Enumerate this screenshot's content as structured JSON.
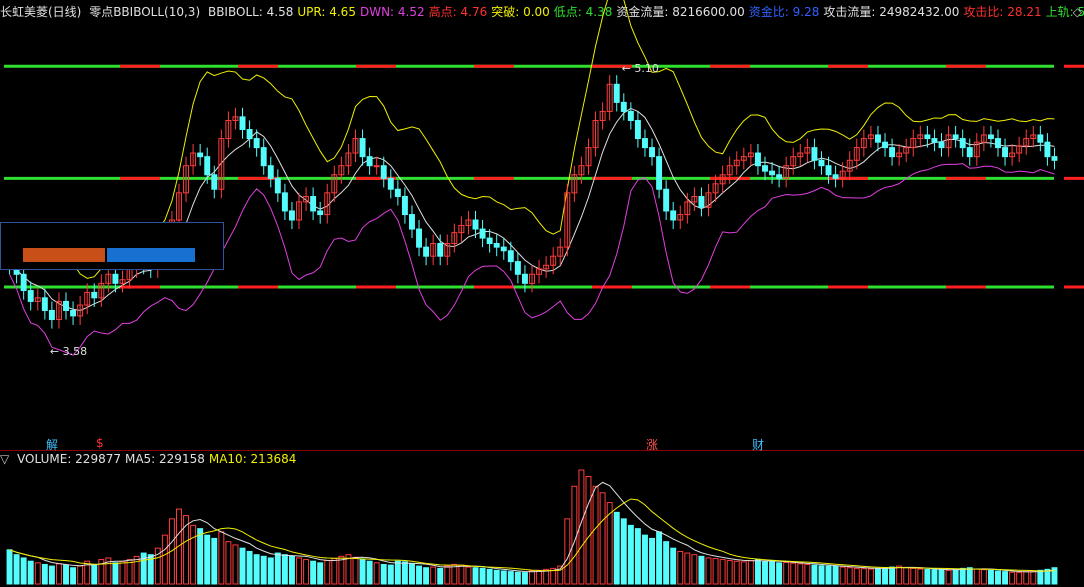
{
  "header": {
    "stock_name": "长虹美菱(日线)",
    "indicator_name": "零点BBIBOLL(10,3)",
    "items": [
      {
        "label": "BBIBOLL:",
        "value": "4.58",
        "color": "#e0e0e0"
      },
      {
        "label": "UPR:",
        "value": "4.65",
        "color": "#f0f000"
      },
      {
        "label": "DWN:",
        "value": "4.52",
        "color": "#e040e0"
      },
      {
        "label": "高点:",
        "value": "4.76",
        "color": "#ff3030"
      },
      {
        "label": "突破:",
        "value": "0.00",
        "color": "#f0f000"
      },
      {
        "label": "低点:",
        "value": "4.38",
        "color": "#30e030"
      },
      {
        "label": "资金流量:",
        "value": "8216600.00",
        "color": "#e0e0e0"
      },
      {
        "label": "资金比:",
        "value": "9.28",
        "color": "#3060ff"
      },
      {
        "label": "攻击流量:",
        "value": "24982432.00",
        "color": "#e0e0e0"
      },
      {
        "label": "攻击比:",
        "value": "28.21",
        "color": "#ff3030"
      },
      {
        "label": "上轨:",
        "value": "5",
        "color": "#30e030"
      }
    ],
    "end_icon": "◇"
  },
  "volume_header": {
    "toggle_icon": "▽",
    "items": [
      {
        "label": "VOLUME:",
        "value": "229877",
        "color": "#e0e0e0"
      },
      {
        "label": "MA5:",
        "value": "229158",
        "color": "#e0e0e0"
      },
      {
        "label": "MA10:",
        "value": "213684",
        "color": "#f0f000"
      }
    ]
  },
  "markers": [
    {
      "text": "解",
      "color": "#40c0ff"
    },
    {
      "text": "$",
      "color": "#ff3030"
    },
    {
      "text": "涨",
      "color": "#ff5050"
    },
    {
      "text": "财",
      "color": "#40c0ff"
    }
  ],
  "colors": {
    "up": "#ff3c3c",
    "down": "#54fcfc",
    "green_line": "#30e030",
    "red_line": "#ff2020",
    "upr": "#f0f000",
    "dwn": "#e040e0",
    "mid": "#e0e0e0"
  },
  "chart_data": [
    {
      "type": "candlestick",
      "title": "长虹美菱(日线)",
      "annotations": [
        {
          "text": "5.10",
          "kind": "high"
        },
        {
          "text": "3.58",
          "kind": "low"
        }
      ],
      "ylim": [
        3.2,
        5.3
      ],
      "support_levels": [
        5.1,
        4.48,
        3.88
      ],
      "x": [
        1,
        2,
        3,
        4,
        5,
        6,
        7,
        8,
        9,
        10,
        11,
        12,
        13,
        14,
        15,
        16,
        17,
        18,
        19,
        20,
        21,
        22,
        23,
        24,
        25,
        26,
        27,
        28,
        29,
        30,
        31,
        32,
        33,
        34,
        35,
        36,
        37,
        38,
        39,
        40,
        41,
        42,
        43,
        44,
        45,
        46,
        47,
        48,
        49,
        50,
        51,
        52,
        53,
        54,
        55,
        56,
        57,
        58,
        59,
        60,
        61,
        62,
        63,
        64,
        65,
        66,
        67,
        68,
        69,
        70,
        71,
        72,
        73,
        74,
        75,
        76,
        77,
        78,
        79,
        80,
        81,
        82,
        83,
        84,
        85,
        86,
        87,
        88,
        89,
        90,
        91,
        92,
        93,
        94,
        95,
        96,
        97,
        98,
        99,
        100,
        101,
        102,
        103,
        104,
        105,
        106,
        107,
        108,
        109,
        110,
        111,
        112,
        113,
        114,
        115,
        116,
        117,
        118,
        119,
        120,
        121,
        122,
        123,
        124,
        125,
        126,
        127,
        128,
        129,
        130,
        131,
        132,
        133,
        134,
        135,
        136,
        137,
        138,
        139,
        140,
        141,
        142,
        143,
        144,
        145,
        146,
        147,
        148,
        149
      ],
      "series": [
        {
          "name": "open",
          "values": [
            4.08,
            4.0,
            3.95,
            3.86,
            3.8,
            3.82,
            3.75,
            3.7,
            3.8,
            3.75,
            3.72,
            3.78,
            3.85,
            3.82,
            3.9,
            3.95,
            3.9,
            3.92,
            3.98,
            4.05,
            4.0,
            3.98,
            4.05,
            4.15,
            4.25,
            4.4,
            4.55,
            4.62,
            4.6,
            4.5,
            4.42,
            4.7,
            4.8,
            4.82,
            4.75,
            4.7,
            4.65,
            4.55,
            4.48,
            4.4,
            4.3,
            4.25,
            4.35,
            4.38,
            4.3,
            4.28,
            4.4,
            4.5,
            4.55,
            4.62,
            4.7,
            4.6,
            4.55,
            4.55,
            4.48,
            4.42,
            4.38,
            4.28,
            4.2,
            4.1,
            4.05,
            4.12,
            4.05,
            4.12,
            4.18,
            4.22,
            4.25,
            4.2,
            4.15,
            4.12,
            4.1,
            4.08,
            4.02,
            3.95,
            3.9,
            3.95,
            3.98,
            4.0,
            4.05,
            4.1,
            4.4,
            4.5,
            4.55,
            4.65,
            4.8,
            4.85,
            5.0,
            4.9,
            4.85,
            4.8,
            4.7,
            4.65,
            4.6,
            4.42,
            4.3,
            4.25,
            4.28,
            4.35,
            4.38,
            4.32,
            4.4,
            4.45,
            4.5,
            4.55,
            4.58,
            4.6,
            4.62,
            4.55,
            4.52,
            4.5,
            4.48,
            4.55,
            4.6,
            4.62,
            4.65,
            4.58,
            4.55,
            4.5,
            4.48,
            4.52,
            4.58,
            4.65,
            4.7,
            4.72,
            4.68,
            4.65,
            4.6,
            4.62,
            4.65,
            4.7,
            4.72,
            4.7,
            4.68,
            4.65,
            4.72,
            4.7,
            4.65,
            4.6,
            4.68,
            4.72,
            4.7,
            4.65,
            4.6,
            4.62,
            4.66,
            4.7,
            4.72,
            4.68,
            4.6
          ]
        },
        {
          "name": "close",
          "values": [
            4.0,
            3.95,
            3.86,
            3.8,
            3.82,
            3.75,
            3.7,
            3.8,
            3.75,
            3.72,
            3.78,
            3.85,
            3.82,
            3.9,
            3.95,
            3.9,
            3.92,
            3.98,
            4.05,
            4.0,
            3.98,
            4.05,
            4.15,
            4.25,
            4.4,
            4.55,
            4.62,
            4.6,
            4.5,
            4.42,
            4.7,
            4.8,
            4.82,
            4.75,
            4.7,
            4.65,
            4.55,
            4.48,
            4.4,
            4.3,
            4.25,
            4.35,
            4.38,
            4.3,
            4.28,
            4.4,
            4.5,
            4.55,
            4.62,
            4.7,
            4.6,
            4.55,
            4.55,
            4.48,
            4.42,
            4.38,
            4.28,
            4.2,
            4.1,
            4.05,
            4.12,
            4.05,
            4.12,
            4.18,
            4.22,
            4.25,
            4.2,
            4.15,
            4.12,
            4.1,
            4.08,
            4.02,
            3.95,
            3.9,
            3.95,
            3.98,
            4.0,
            4.05,
            4.1,
            4.4,
            4.5,
            4.55,
            4.65,
            4.8,
            4.85,
            5.0,
            4.9,
            4.85,
            4.8,
            4.7,
            4.65,
            4.6,
            4.42,
            4.3,
            4.25,
            4.28,
            4.35,
            4.38,
            4.32,
            4.4,
            4.45,
            4.5,
            4.55,
            4.58,
            4.6,
            4.62,
            4.55,
            4.52,
            4.5,
            4.48,
            4.55,
            4.6,
            4.62,
            4.65,
            4.58,
            4.55,
            4.5,
            4.48,
            4.52,
            4.58,
            4.65,
            4.7,
            4.72,
            4.68,
            4.65,
            4.6,
            4.62,
            4.65,
            4.7,
            4.72,
            4.7,
            4.68,
            4.65,
            4.72,
            4.7,
            4.65,
            4.6,
            4.68,
            4.72,
            4.7,
            4.65,
            4.6,
            4.62,
            4.66,
            4.7,
            4.72,
            4.68,
            4.6,
            4.58
          ]
        },
        {
          "name": "volume",
          "values": [
            105000,
            90000,
            80000,
            70000,
            65000,
            60000,
            55000,
            62000,
            58000,
            50000,
            55000,
            70000,
            60000,
            75000,
            80000,
            65000,
            70000,
            75000,
            85000,
            95000,
            90000,
            110000,
            150000,
            200000,
            230000,
            210000,
            180000,
            170000,
            150000,
            140000,
            160000,
            130000,
            120000,
            110000,
            100000,
            90000,
            85000,
            80000,
            95000,
            90000,
            85000,
            80000,
            75000,
            70000,
            65000,
            72000,
            78000,
            85000,
            90000,
            82000,
            75000,
            70000,
            65000,
            60000,
            58000,
            70000,
            68000,
            62000,
            55000,
            50000,
            52000,
            48000,
            55000,
            60000,
            58000,
            52000,
            50000,
            48000,
            45000,
            42000,
            40000,
            38000,
            36000,
            35000,
            40000,
            42000,
            45000,
            48000,
            55000,
            200000,
            300000,
            350000,
            330000,
            300000,
            280000,
            250000,
            220000,
            200000,
            180000,
            170000,
            150000,
            140000,
            160000,
            130000,
            110000,
            100000,
            95000,
            90000,
            85000,
            80000,
            78000,
            75000,
            72000,
            70000,
            68000,
            72000,
            75000,
            70000,
            68000,
            65000,
            66000,
            64000,
            62000,
            60000,
            58000,
            56000,
            55000,
            54000,
            52000,
            50000,
            48000,
            47000,
            46000,
            48000,
            50000,
            52000,
            55000,
            50000,
            48000,
            46000,
            45000,
            44000,
            43000,
            42000,
            45000,
            48000,
            50000,
            46000,
            44000,
            42000,
            40000,
            38000,
            36000,
            35000,
            38000,
            40000,
            42000,
            45000,
            50000
          ]
        }
      ]
    }
  ]
}
